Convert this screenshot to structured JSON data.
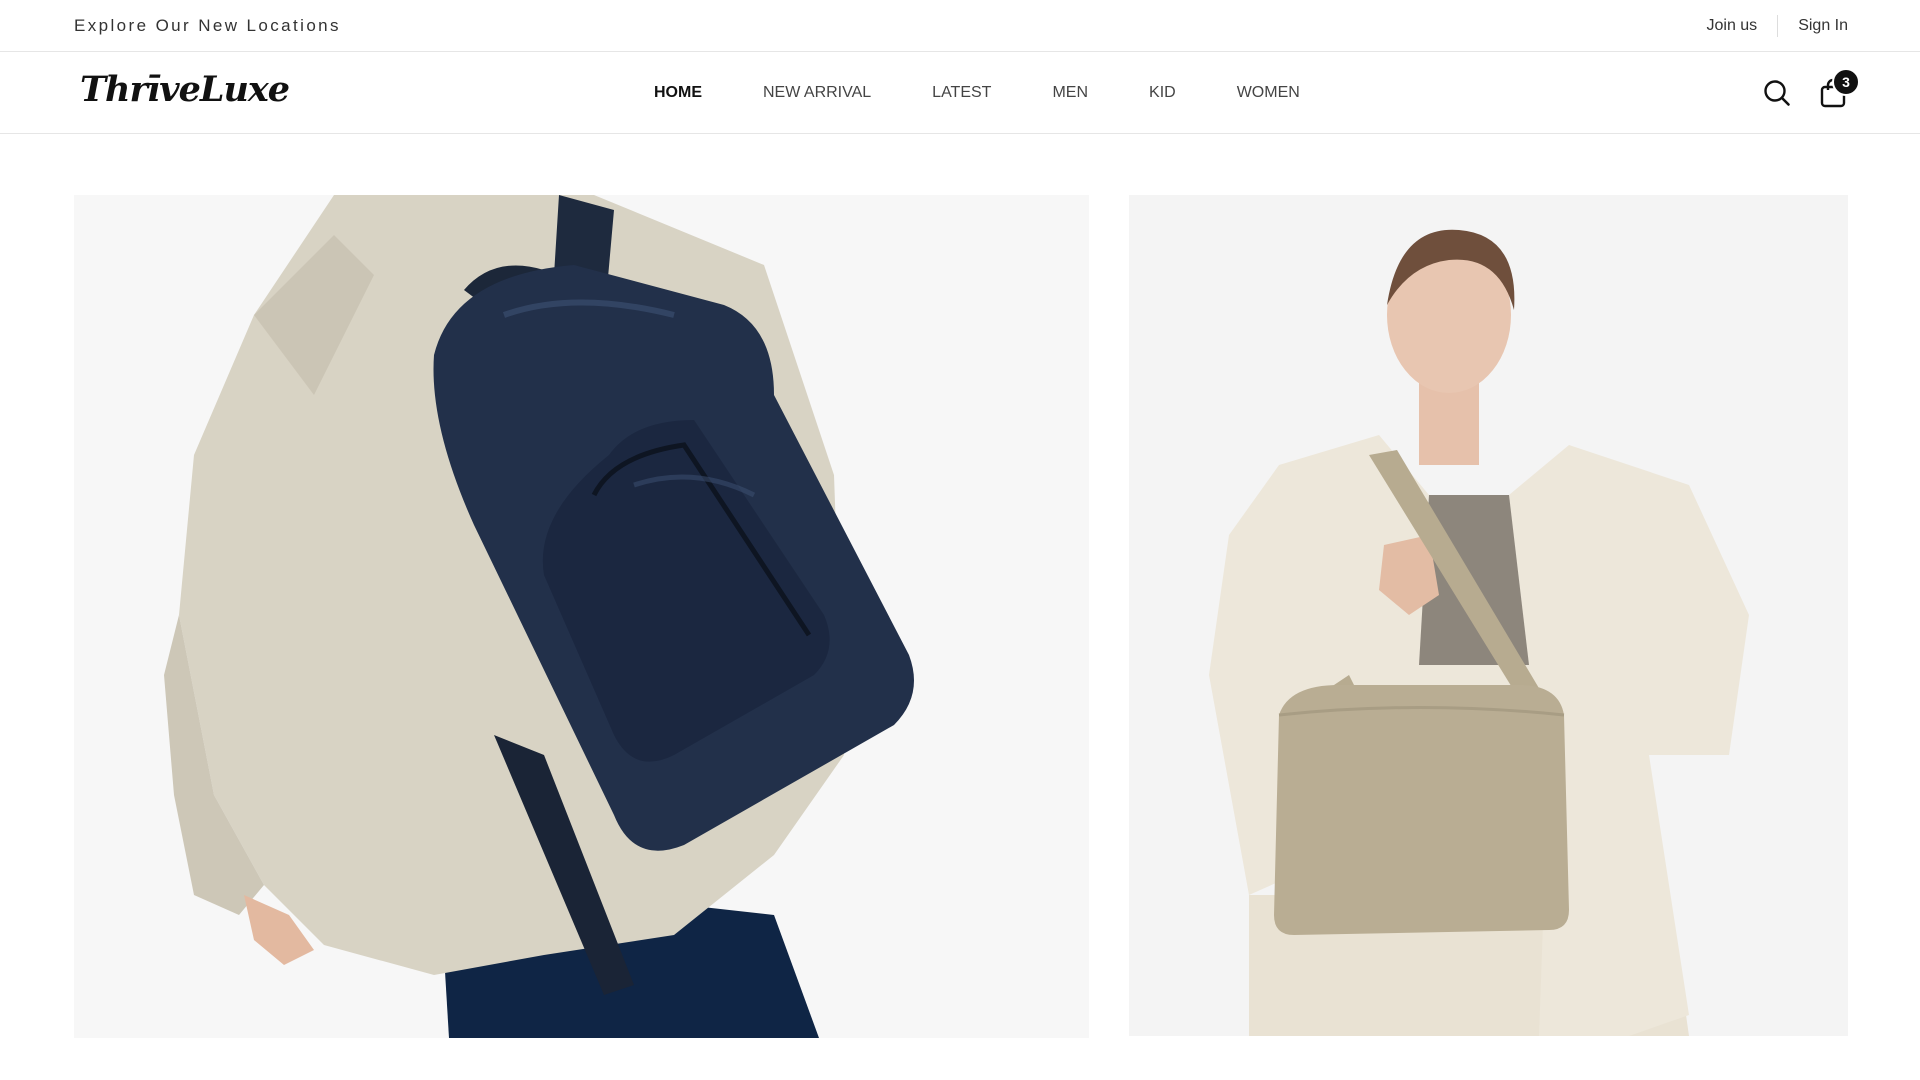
{
  "topbar": {
    "promo": "Explore Our New Locations",
    "join_label": "Join us",
    "signin_label": "Sign In"
  },
  "header": {
    "logo": "ThrīveLuxe",
    "nav": [
      {
        "label": "HOME",
        "active": true
      },
      {
        "label": "NEW ARRIVAL"
      },
      {
        "label": "LATEST"
      },
      {
        "label": "MEN"
      },
      {
        "label": "KID"
      },
      {
        "label": "WOMEN"
      }
    ],
    "icons": [
      "search-icon",
      "shopping-bag-icon"
    ],
    "cart_count": "3"
  },
  "hero": {
    "left_image": "man-with-navy-croc-leather-backpack",
    "right_image": "woman-with-beige-shoulder-bag"
  },
  "colors": {
    "text": "#222222",
    "badge": "#111111",
    "border": "#e6e6e6",
    "backpack": "#1f2a3d",
    "handbag": "#b9ad93"
  }
}
